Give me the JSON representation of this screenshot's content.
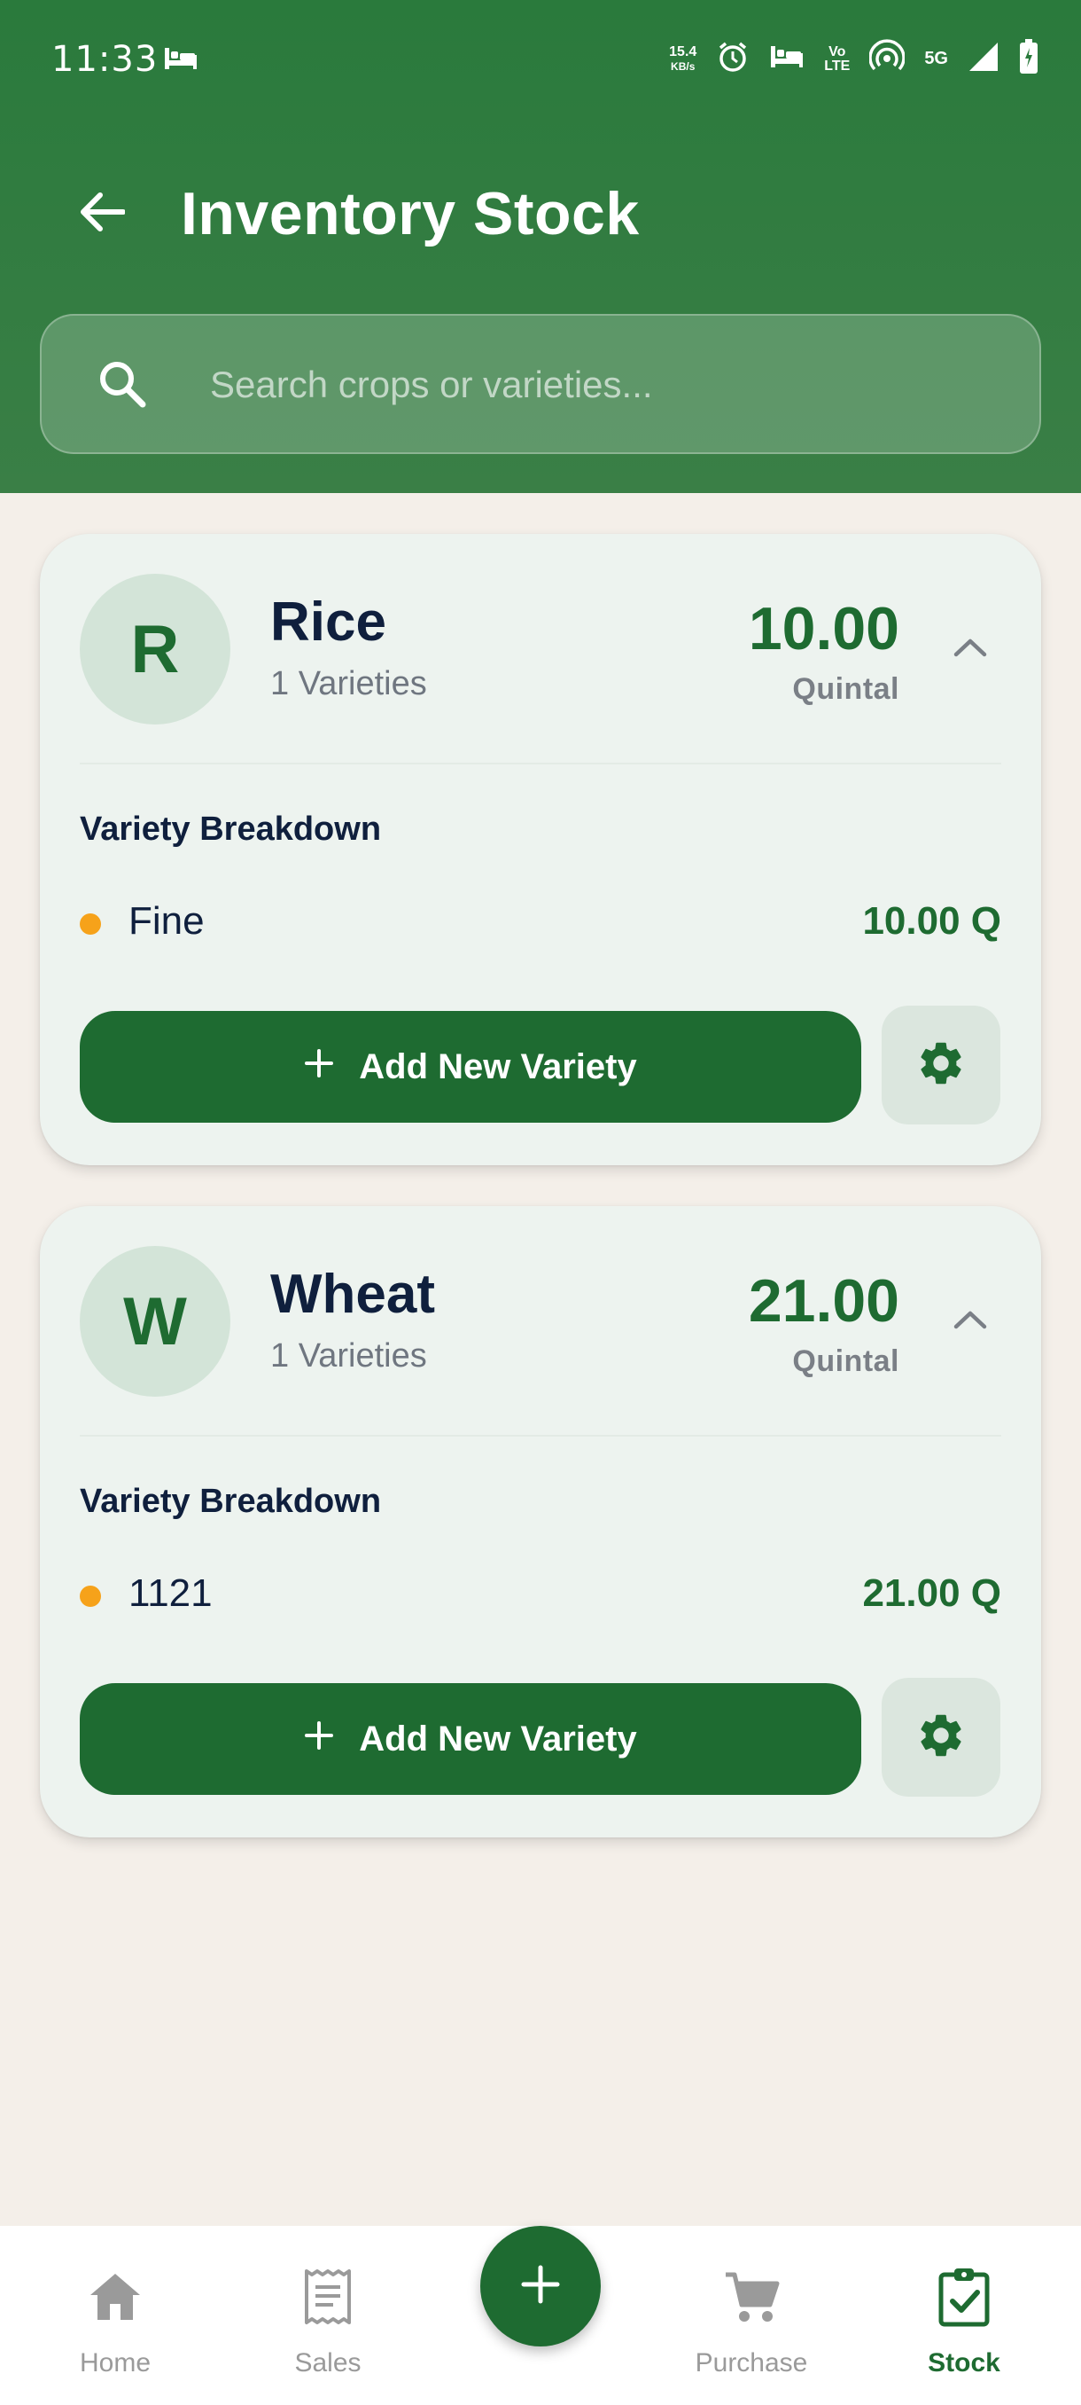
{
  "status_bar": {
    "time": "11:33",
    "net_speed_top": "15.4",
    "net_speed_bottom": "KB/s",
    "volte_top": "Vo",
    "volte_bottom": "LTE",
    "network": "5G"
  },
  "header": {
    "title": "Inventory Stock"
  },
  "search": {
    "placeholder": "Search crops or varieties..."
  },
  "crops": [
    {
      "initial": "R",
      "name": "Rice",
      "varieties_count": "1 Varieties",
      "quantity": "10.00",
      "unit": "Quintal",
      "breakdown_title": "Variety Breakdown",
      "varieties": [
        {
          "name": "Fine",
          "qty": "10.00 Q"
        }
      ],
      "add_label": "Add New Variety"
    },
    {
      "initial": "W",
      "name": "Wheat",
      "varieties_count": "1 Varieties",
      "quantity": "21.00",
      "unit": "Quintal",
      "breakdown_title": "Variety Breakdown",
      "varieties": [
        {
          "name": "1121",
          "qty": "21.00 Q"
        }
      ],
      "add_label": "Add New Variety"
    }
  ],
  "bottom_nav": {
    "items": [
      {
        "label": "Home",
        "icon": "home-icon"
      },
      {
        "label": "Sales",
        "icon": "receipt-icon"
      },
      {
        "label": "Purchase",
        "icon": "cart-icon"
      },
      {
        "label": "Stock",
        "icon": "clipboard-check-icon",
        "active": true
      }
    ],
    "fab_icon": "plus-icon"
  },
  "colors": {
    "primary": "#1e6b31",
    "header": "#2a7a3c",
    "background": "#f4efe9",
    "card": "#edf3ef",
    "accent_dot": "#f6a21a"
  }
}
